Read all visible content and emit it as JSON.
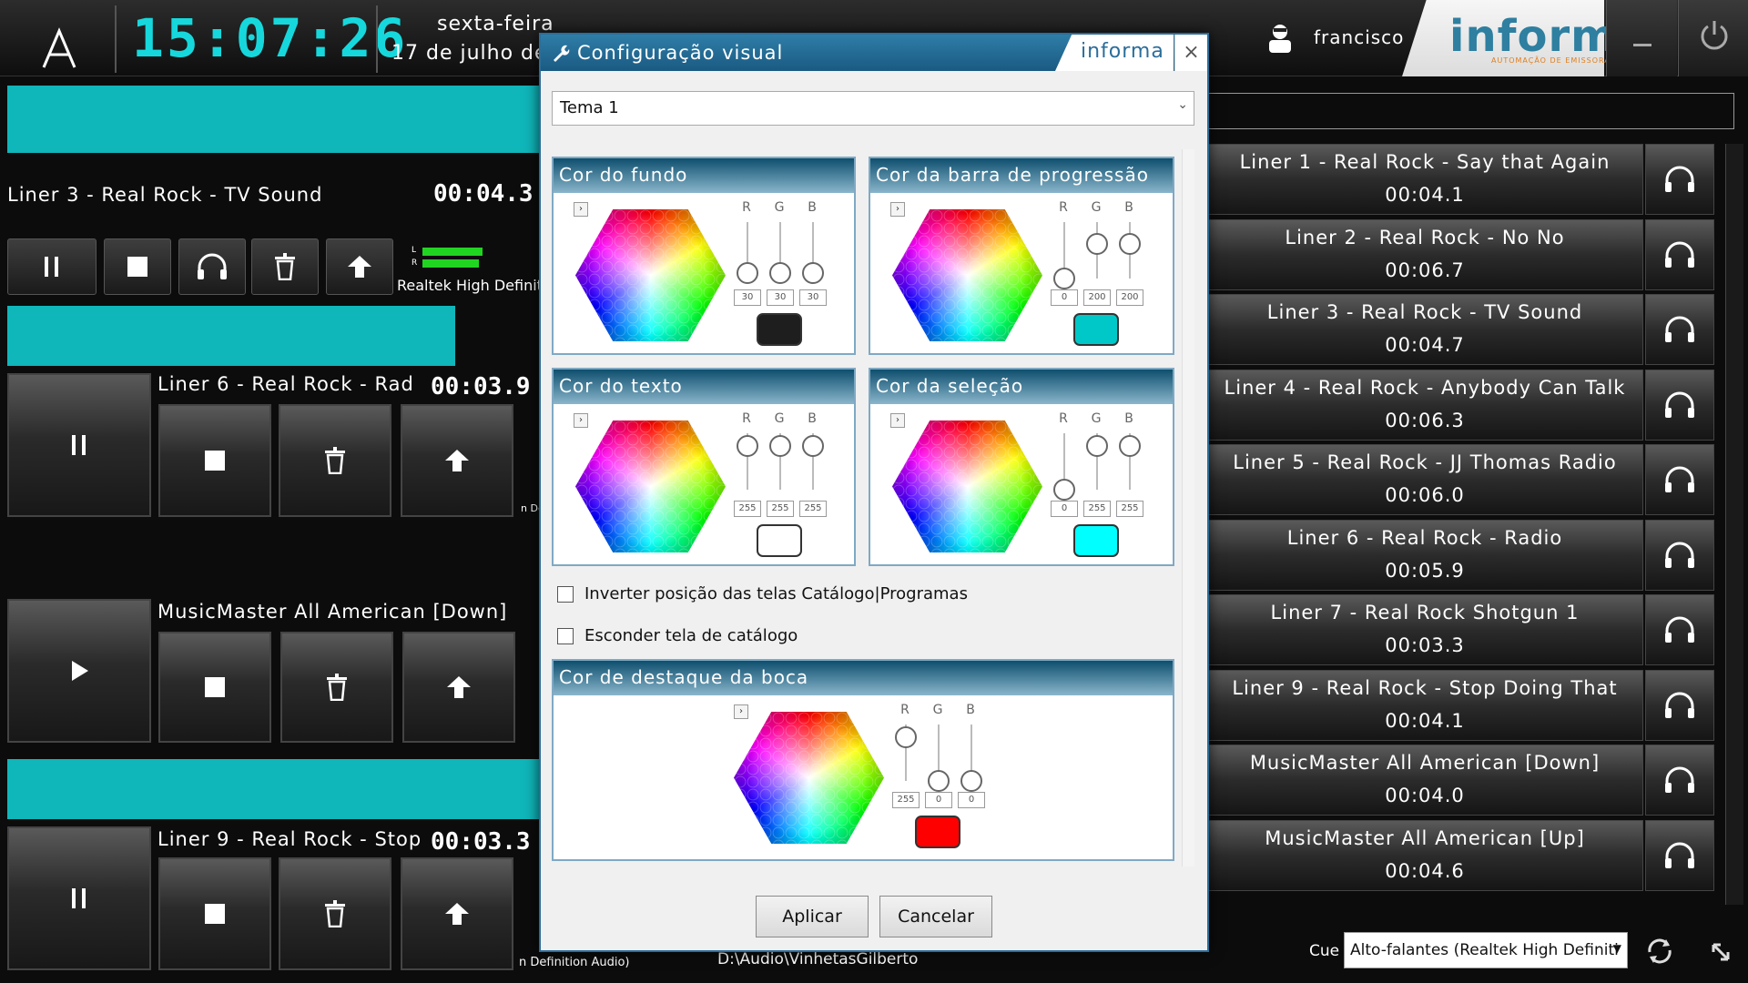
{
  "topbar": {
    "clock": "15:07:26",
    "weekday": "sexta-feira",
    "date": "17 de julho de",
    "user": "francisco",
    "brand": "informa",
    "brand_sub": "AUTOMAÇÃO DE EMISSORAS"
  },
  "left": {
    "player1": {
      "title": "Liner 3 - Real Rock - TV Sound",
      "time": "00:04.3",
      "device": "Realtek High Definit",
      "meter_l": "L",
      "meter_r": "R"
    },
    "player2": {
      "title": "Liner 6 - Real Rock - Rad",
      "time": "00:03.9",
      "device_fragment": "n De"
    },
    "player3": {
      "title": "MusicMaster All American [Down]"
    },
    "player4": {
      "title": "Liner 9 - Real Rock - Stop",
      "time": "00:03.3",
      "device": "n Definition Audio)"
    }
  },
  "right_list": [
    {
      "title": "Liner 1 - Real Rock - Say that Again",
      "duration": "00:04.1"
    },
    {
      "title": "Liner 2 - Real Rock - No No",
      "duration": "00:06.7"
    },
    {
      "title": "Liner 3 - Real Rock - TV Sound",
      "duration": "00:04.7"
    },
    {
      "title": "Liner 4 - Real Rock - Anybody Can Talk",
      "duration": "00:06.3"
    },
    {
      "title": "Liner 5 - Real Rock - JJ Thomas Radio",
      "duration": "00:06.0"
    },
    {
      "title": "Liner 6 - Real Rock - Radio",
      "duration": "00:05.9"
    },
    {
      "title": "Liner 7 - Real Rock Shotgun 1",
      "duration": "00:03.3"
    },
    {
      "title": "Liner 9 - Real Rock - Stop Doing That",
      "duration": "00:04.1"
    },
    {
      "title": "MusicMaster All American [Down]",
      "duration": "00:04.0"
    },
    {
      "title": "MusicMaster All American [Up]",
      "duration": "00:04.6"
    }
  ],
  "dialog": {
    "title": "Configuração visual",
    "brand": "informa",
    "close": "×",
    "theme": "Tema 1",
    "groups": {
      "background": {
        "label": "Cor do fundo",
        "r": "30",
        "g": "30",
        "b": "30",
        "swatch": "#1e1e1e"
      },
      "progress": {
        "label": "Cor da barra de progressão",
        "r": "0",
        "g": "200",
        "b": "200",
        "swatch": "#00c8c8"
      },
      "text": {
        "label": "Cor do texto",
        "r": "255",
        "g": "255",
        "b": "255",
        "swatch": "#ffffff"
      },
      "selection": {
        "label": "Cor da seleção",
        "r": "0",
        "g": "255",
        "b": "255",
        "swatch": "#00ffff"
      },
      "highlight": {
        "label": "Cor de destaque da boca",
        "r": "255",
        "g": "0",
        "b": "0",
        "swatch": "#ff0000"
      }
    },
    "rgb_labels": {
      "r": "R",
      "g": "G",
      "b": "B"
    },
    "checkbox_swap": "Inverter posição das telas Catálogo|Programas",
    "checkbox_hide": "Esconder tela de catálogo",
    "apply": "Aplicar",
    "cancel": "Cancelar"
  },
  "footer": {
    "path": "D:\\Audio\\VinhetasGilberto",
    "cue_label": "Cue",
    "cue_device": "Alto-falantes (Realtek High Definiti"
  },
  "colors": {
    "accent": "#16d8dc",
    "teal": "#0fb6ba",
    "dialog_blue": "#2b6d9a"
  }
}
